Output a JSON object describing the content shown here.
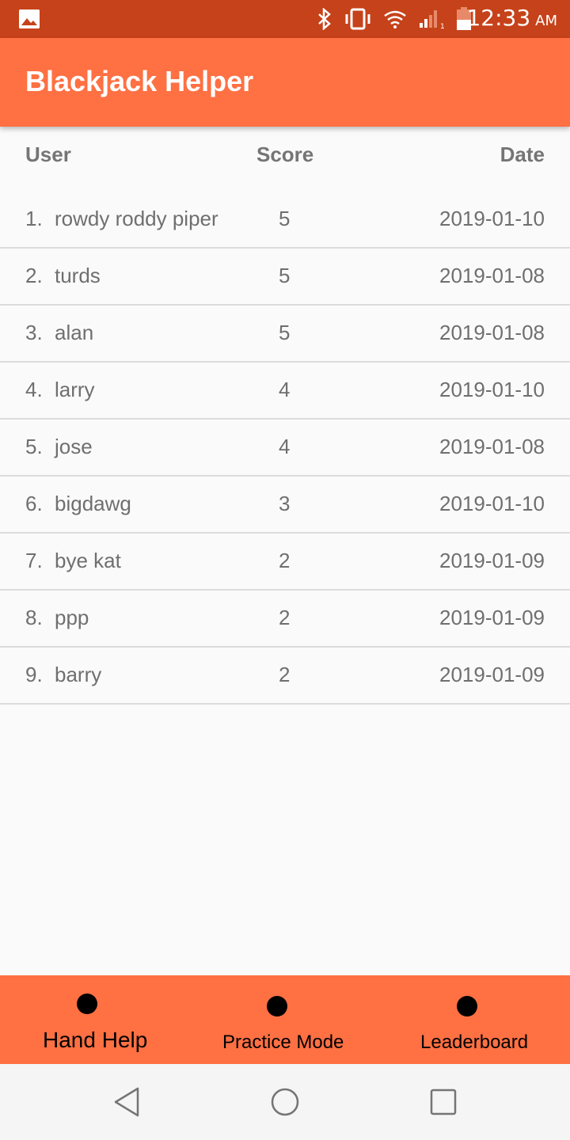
{
  "status_bar": {
    "time": "12:33",
    "ampm": "AM",
    "icons": [
      "image-icon",
      "bluetooth-icon",
      "vibrate-icon",
      "wifi-icon",
      "signal-icon",
      "battery-icon"
    ],
    "background_color": "#c6421a"
  },
  "app_bar": {
    "title": "Blackjack Helper",
    "background_color": "#ff7043"
  },
  "leaderboard": {
    "columns": [
      "User",
      "Score",
      "Date"
    ],
    "rows": [
      {
        "rank": "1.",
        "user": "rowdy roddy piper",
        "score": "5",
        "date": "2019-01-10"
      },
      {
        "rank": "2.",
        "user": "turds",
        "score": "5",
        "date": "2019-01-08"
      },
      {
        "rank": "3.",
        "user": "alan",
        "score": "5",
        "date": "2019-01-08"
      },
      {
        "rank": "4.",
        "user": "larry",
        "score": "4",
        "date": "2019-01-10"
      },
      {
        "rank": "5.",
        "user": "jose",
        "score": "4",
        "date": "2019-01-08"
      },
      {
        "rank": "6.",
        "user": "bigdawg",
        "score": "3",
        "date": "2019-01-10"
      },
      {
        "rank": "7.",
        "user": "bye kat",
        "score": "2",
        "date": "2019-01-09"
      },
      {
        "rank": "8.",
        "user": "ppp",
        "score": "2",
        "date": "2019-01-09"
      },
      {
        "rank": "9.",
        "user": "barry",
        "score": "2",
        "date": "2019-01-09"
      }
    ]
  },
  "bottom_nav": {
    "items": [
      {
        "label": "Hand Help",
        "icon": "dot-icon"
      },
      {
        "label": "Practice Mode",
        "icon": "dot-icon"
      },
      {
        "label": "Leaderboard",
        "icon": "dot-icon"
      }
    ]
  },
  "system_nav": {
    "icons": [
      "back-icon",
      "home-icon",
      "recent-apps-icon"
    ]
  }
}
